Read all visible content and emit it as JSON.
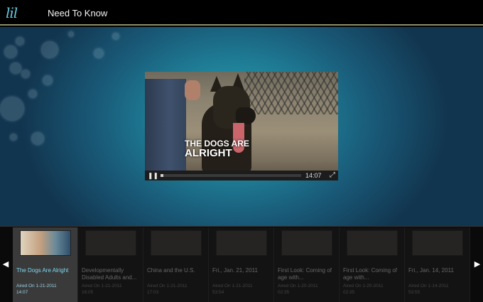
{
  "header": {
    "logo": "lil",
    "title": "Need To Know"
  },
  "player": {
    "caption_line1": "THE DOGS ARE",
    "caption_line2": "ALRIGHT",
    "time": "14:07",
    "progress": 0.02,
    "pause_glyph": "❚❚",
    "fullscreen_glyph": "⤢"
  },
  "strip": {
    "left_arrow": "◀",
    "right_arrow": "▶",
    "tiles": [
      {
        "title": "The Dogs Are Alright",
        "aired": "Aired On 1-21-2011",
        "duration": "14:07"
      },
      {
        "title": "Developmentally Disabled Adults and...",
        "aired": "Aired On 1-21-2011",
        "duration": "16:05"
      },
      {
        "title": "China and the U.S.",
        "aired": "Aired On 1-21-2011",
        "duration": "17:03"
      },
      {
        "title": "Fri., Jan. 21, 2011",
        "aired": "Aired On 1-21-2011",
        "duration": "53:54"
      },
      {
        "title": "First Look: Coming of age with...",
        "aired": "Aired On 1-20-2011",
        "duration": "02:35"
      },
      {
        "title": "First Look: Coming of age with...",
        "aired": "Aired On 1-20-2011",
        "duration": "02:35"
      },
      {
        "title": "Fri., Jan. 14, 2011",
        "aired": "Aired On 1-14-2011",
        "duration": "53:55"
      }
    ]
  },
  "colors": {
    "accent": "#7fd6ef",
    "header_rule": "#8d8f6a"
  }
}
